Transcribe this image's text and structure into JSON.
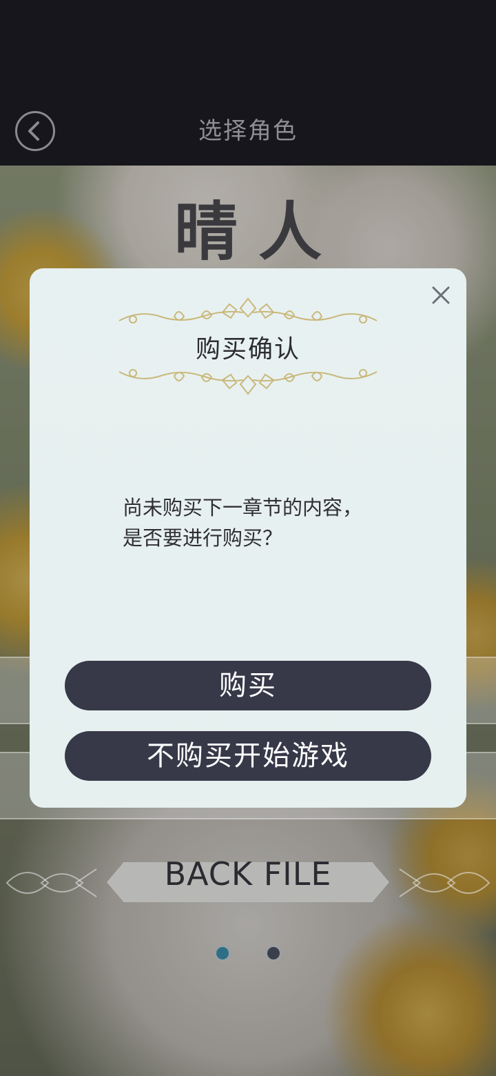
{
  "nav": {
    "back_icon": "chevron-left-icon",
    "title": "选择角色"
  },
  "background": {
    "character_name": "晴人",
    "menu_button_label": "BACK FILE",
    "page_dots": [
      {
        "active": true,
        "color": "#2e6f86"
      },
      {
        "active": false,
        "color": "#3a3f4a"
      }
    ]
  },
  "modal": {
    "title": "购买确认",
    "close_icon": "close-icon",
    "message_line1": "尚未购买下一章节的内容，",
    "message_line2": "是否要进行购买？",
    "buy_label": "购买",
    "skip_label": "不购买开始游戏"
  },
  "colors": {
    "modal_bg": "#e7f0f0",
    "button_bg": "#373848",
    "button_text": "#ffffff",
    "ornament_gold": "#c9b87a"
  }
}
